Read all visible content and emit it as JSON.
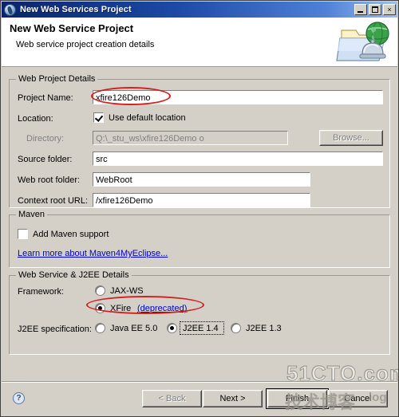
{
  "window": {
    "title": "New Web Services Project",
    "icon": "myeclipse-app-icon",
    "minimize_label": "",
    "maximize_label": "",
    "close_label": "×"
  },
  "header": {
    "title": "New Web Service Project",
    "subtitle": "Web service project creation details",
    "icon": "web-service-folder-globe-icon"
  },
  "web_project_details": {
    "group_title": "Web Project Details",
    "project_name_label": "Project Name:",
    "project_name_value": "xfire126Demo",
    "location_label": "Location:",
    "use_default_location_label": "Use default location",
    "use_default_location_checked": true,
    "directory_label": "Directory:",
    "directory_value": "Q:\\_stu_ws\\xfire126Demo o",
    "browse_label": "Browse...",
    "source_folder_label": "Source folder:",
    "source_folder_value": "src",
    "web_root_folder_label": "Web root folder:",
    "web_root_folder_value": "WebRoot",
    "context_root_label": "Context root URL:",
    "context_root_value": "/xfire126Demo"
  },
  "maven": {
    "group_title": "Maven",
    "add_maven_label": "Add Maven support",
    "add_maven_checked": false,
    "learn_more_label": "Learn more about Maven4MyEclipse..."
  },
  "web_service_j2ee": {
    "group_title": "Web Service & J2EE Details",
    "framework_label": "Framework:",
    "framework_options": [
      {
        "label": "JAX-WS",
        "selected": false
      },
      {
        "label": "XFire",
        "suffix": "(deprecated)",
        "selected": true
      }
    ],
    "j2ee_label": "J2EE specification:",
    "j2ee_options": [
      {
        "label": "Java EE 5.0",
        "selected": false,
        "focused": false
      },
      {
        "label": "J2EE 1.4",
        "selected": true,
        "focused": true
      },
      {
        "label": "J2EE 1.3",
        "selected": false,
        "focused": false
      }
    ]
  },
  "footer": {
    "help_label": "?",
    "back_label": "< Back",
    "back_disabled": true,
    "next_label": "Next >",
    "finish_label": "Finish",
    "finish_default": true,
    "cancel_label": "Cancel"
  },
  "watermark": {
    "main": "51CTO.com",
    "chinese": "技术博客",
    "log": "log"
  },
  "colors": {
    "dialog_face": "#d4d0c8",
    "title_start": "#0a246a",
    "title_end": "#9fc0ee",
    "link": "#0000cc",
    "annotation": "#d02020"
  }
}
